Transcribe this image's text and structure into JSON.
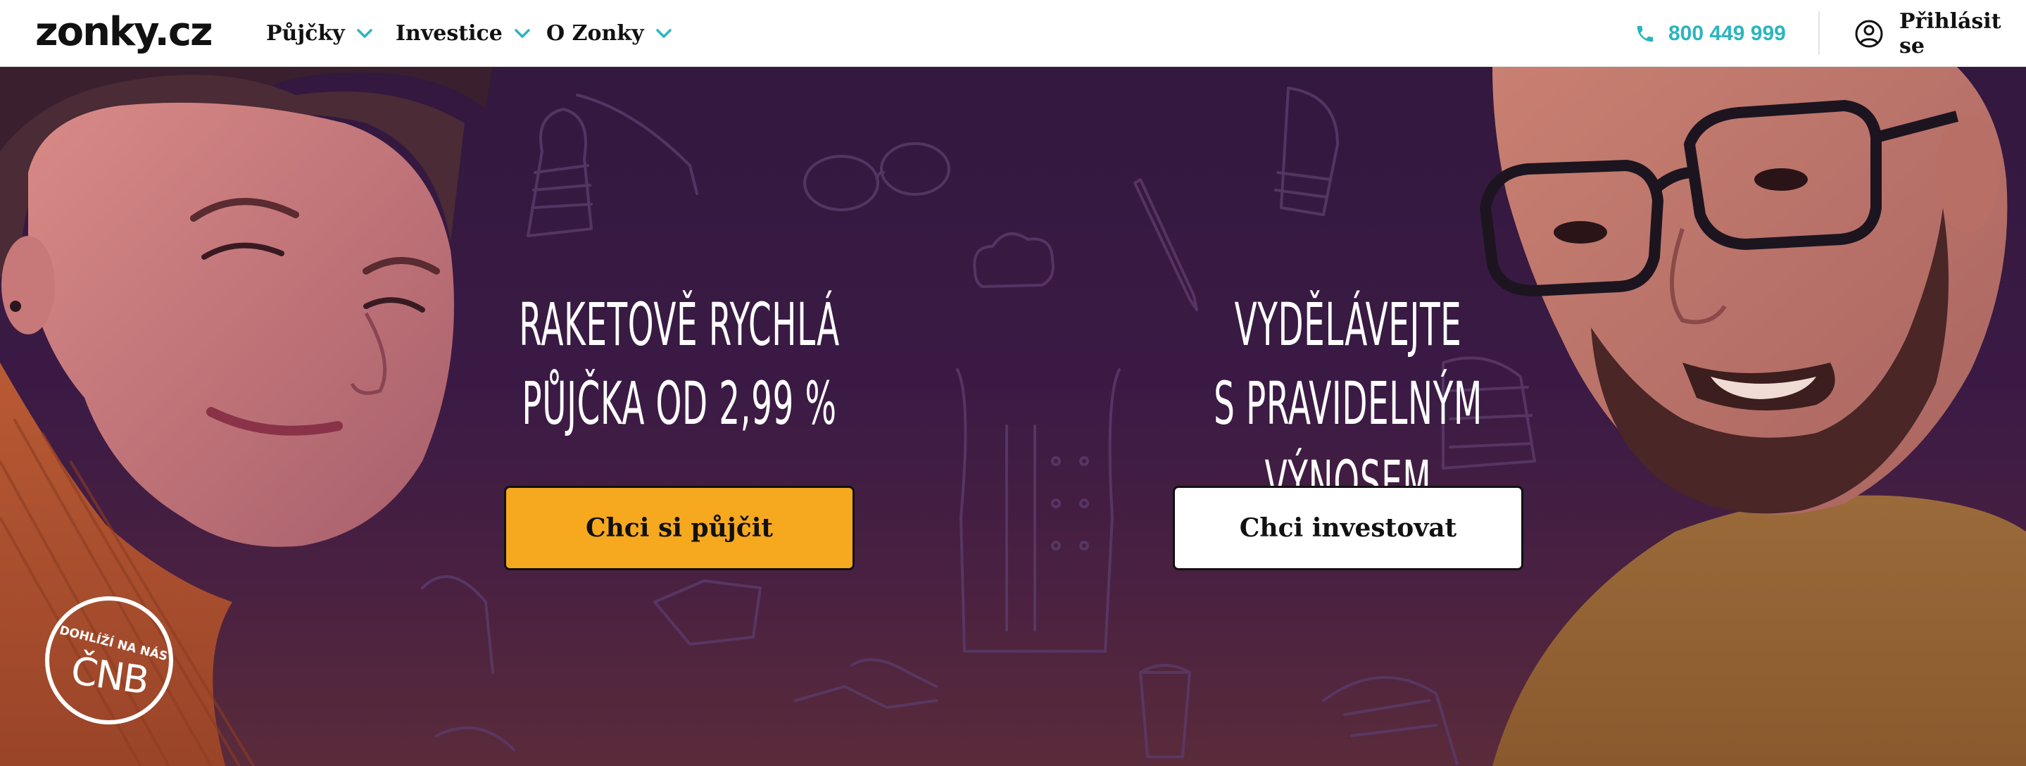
{
  "brand": {
    "logo_text": "zonky.cz"
  },
  "nav": {
    "items": [
      {
        "label": "Půjčky"
      },
      {
        "label": "Investice"
      },
      {
        "label": "O Zonky"
      }
    ],
    "phone": "800 449 999",
    "login_label": "Přihlásit se"
  },
  "hero": {
    "loan": {
      "headline_line1": "RAKETOVĚ RYCHLÁ",
      "headline_line2": "PŮJČKA OD 2,99 %",
      "button_label": "Chci si půjčit"
    },
    "invest": {
      "headline_line1": "VYDĚLÁVEJTE",
      "headline_line2": "S PRAVIDELNÝM VÝNOSEM",
      "button_label": "Chci investovat"
    },
    "badge": {
      "line1": "DOHLÍŽÍ NA NÁS",
      "line2": "ČNB"
    }
  },
  "colors": {
    "accent_teal": "#2cb5be",
    "loan_button": "#f6a91f",
    "hero_purple": "#33183f"
  }
}
